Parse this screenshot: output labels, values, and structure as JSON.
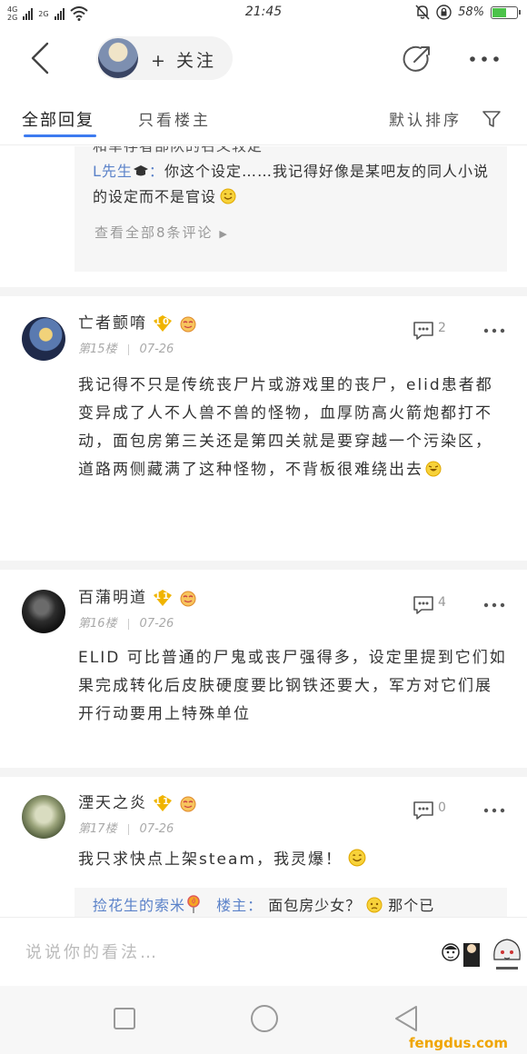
{
  "status_bar": {
    "network_top": "4G",
    "network_bottom": "2G",
    "network_mid": "2G",
    "time": "21:45",
    "battery": "58%",
    "battery_level": 0.58
  },
  "navbar": {
    "follow_label": "+ 关注"
  },
  "tabs": {
    "all_replies": "全部回复",
    "host_only": "只看楼主",
    "sort": "默认排序"
  },
  "quoted_replies": {
    "partial_line": "和幸存者部队的名义较定",
    "reply_user": "L先生",
    "reply_colon": "：",
    "reply_text": "你这个设定……我记得好像是某吧友的同人小说的设定而不是官设",
    "view_all": "查看全部8条评论"
  },
  "posts": [
    {
      "name": "亡者颤唷",
      "level": "10",
      "floor": "第15楼",
      "date": "07-26",
      "reply_count": "2",
      "body": "我记得不只是传统丧尸片或游戏里的丧尸，elid患者都变异成了人不人兽不兽的怪物，血厚防高火箭炮都打不动，面包房第三关还是第四关就是要穿越一个污染区，道路两侧藏满了这种怪物，不背板很难绕出去"
    },
    {
      "name": "百蒲明道",
      "level": "11",
      "floor": "第16楼",
      "date": "07-26",
      "reply_count": "4",
      "body": "ELID 可比普通的尸鬼或丧尸强得多，设定里提到它们如果完成转化后皮肤硬度要比钢铁还要大，军方对它们展开行动要用上特殊单位"
    },
    {
      "name": "湮天之炎",
      "level": "11",
      "floor": "第17楼",
      "date": "07-26",
      "reply_count": "0",
      "body": "我只求快点上架steam，我灵爆！"
    }
  ],
  "sub_reply": {
    "user": "捡花生的索米",
    "host_tag": "楼主",
    "colon": "：",
    "text": "面包房少女？",
    "tail": "那个已"
  },
  "input": {
    "placeholder": "说说你的看法…"
  },
  "watermark": "fengdus.com",
  "colors": {
    "accent": "#3d7bf0",
    "username_blue": "#5b82c9",
    "level_gold": "#f0b400",
    "watermark_orange": "#f0a500"
  }
}
